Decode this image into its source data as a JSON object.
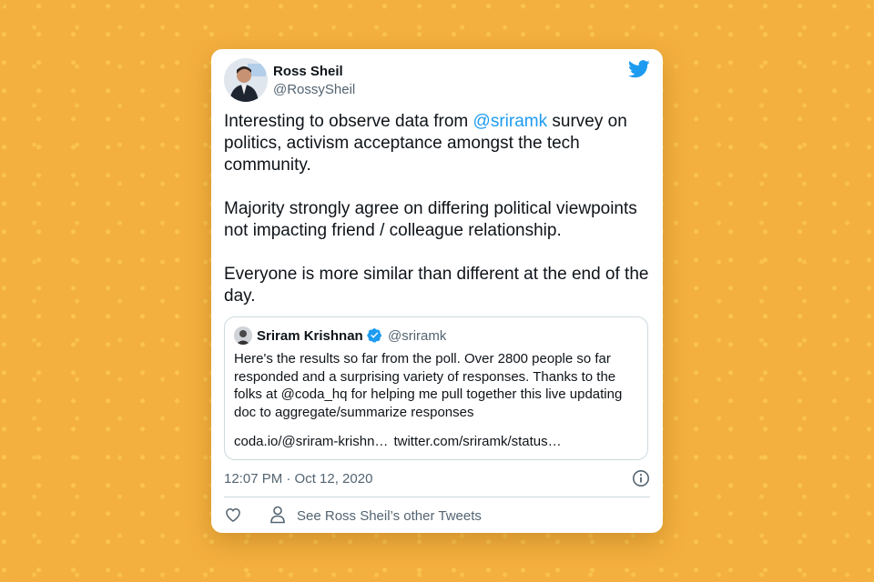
{
  "tweet": {
    "author_name": "Ross Sheil",
    "author_handle": "@RossySheil",
    "text_before_mention": "Interesting to observe data from ",
    "mention": "@sriramk",
    "text_after_mention": " survey on politics, activism acceptance amongst the tech community.\n\nMajority strongly agree on differing political viewpoints not impacting friend / colleague relationship.\n\nEveryone is more similar than different at the end of the day.",
    "timestamp": "12:07 PM · Oct 12, 2020",
    "other_tweets_label": "See Ross Sheil’s other Tweets"
  },
  "quote": {
    "author_name": "Sriram Krishnan",
    "author_handle": "@sriramk",
    "text": "Here's the results so far from the poll. Over 2800 people so far responded and a surprising variety of responses. Thanks to the folks at @coda_hq for helping me pull together this live updating doc to aggregate/summarize responses",
    "link_1": "coda.io/@sriram-krishn…",
    "link_2": "twitter.com/sriramk/status…"
  },
  "icons": {
    "brand": "twitter-bird-icon",
    "verified": "verified-badge-icon",
    "info": "info-icon",
    "like": "heart-icon",
    "profile": "person-icon"
  },
  "colors": {
    "background": "#f4b03e",
    "accent": "#1d9bf0",
    "text": "#0f1419",
    "muted": "#536471"
  }
}
